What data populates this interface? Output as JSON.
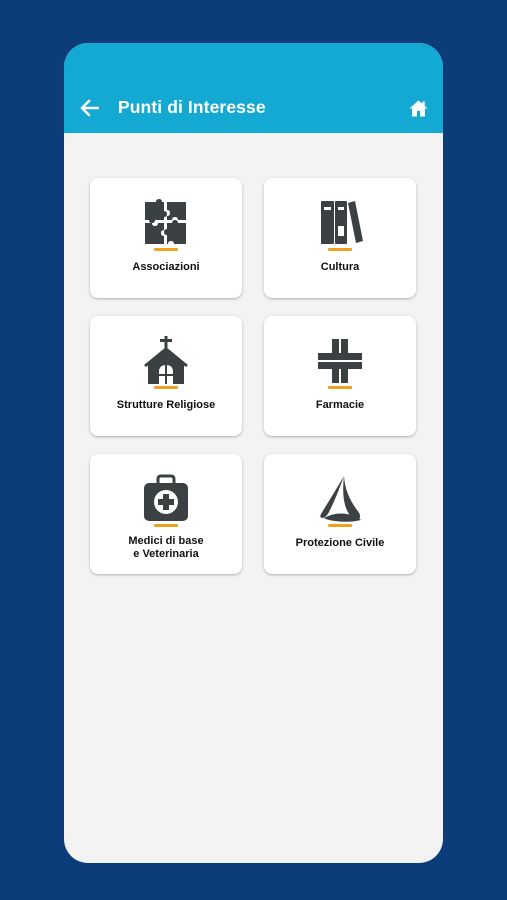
{
  "appbar": {
    "title": "Punti di Interesse",
    "back_icon": "arrow-left-icon",
    "home_icon": "home-icon",
    "color": "#14a9d3"
  },
  "colors": {
    "background": "#0c3d7a",
    "content": "#f3f3f4",
    "icon": "#3b4043",
    "accent": "#f0a21e"
  },
  "categories": [
    {
      "label": "Associazioni",
      "icon": "puzzle-icon"
    },
    {
      "label": "Cultura",
      "icon": "books-icon"
    },
    {
      "label": "Strutture Religiose",
      "icon": "church-icon"
    },
    {
      "label": "Farmacie",
      "icon": "pharmacy-cross-icon"
    },
    {
      "label_line1": "Medici di base",
      "label_line2": "e Veterinaria",
      "icon": "medical-kit-icon"
    },
    {
      "label": "Protezione Civile",
      "icon": "civil-protection-icon"
    }
  ]
}
